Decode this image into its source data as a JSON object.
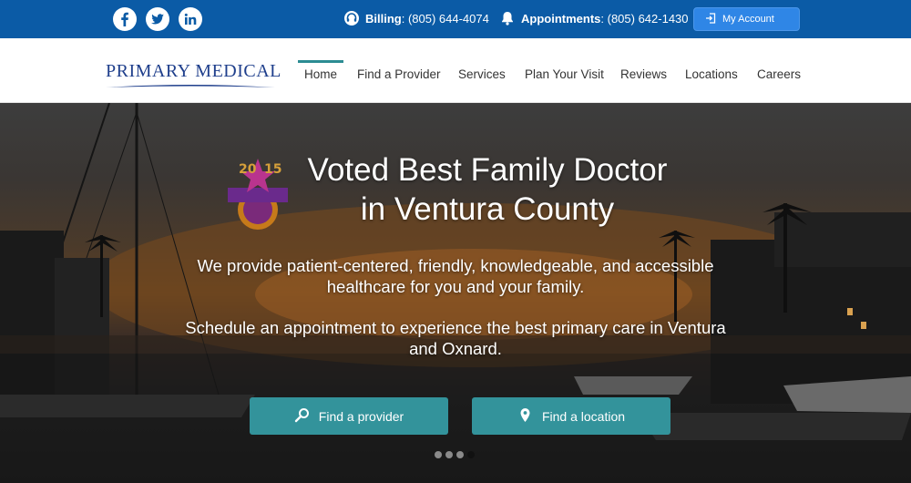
{
  "topbar": {
    "social": [
      "facebook-icon",
      "twitter-icon",
      "linkedin-icon"
    ],
    "billing_label": "Billing",
    "billing_phone": ": (805) 644-4074",
    "appointments_label": "Appointments",
    "appointments_phone": ": (805) 642-1430",
    "account_button": "My Account"
  },
  "logo": {
    "text": "PRIMARY MEDICAL"
  },
  "nav": {
    "items": [
      "Home",
      "Find a Provider",
      "Services",
      "Plan Your Visit",
      "Reviews",
      "Locations",
      "Careers"
    ],
    "active": "Home"
  },
  "hero": {
    "headline_line1": "Voted Best Family Doctor",
    "headline_line2": "in Ventura County",
    "badge_year": "2015",
    "paragraph1": "We provide patient-centered, friendly, knowledgeable, and accessible healthcare for you and your family.",
    "paragraph2": "Schedule an appointment to experience the best primary care in Ventura and Oxnard.",
    "cta_provider": "Find a provider",
    "cta_location": "Find a location",
    "slides": {
      "count": 4,
      "active": 4
    }
  },
  "colors": {
    "topbar": "#0b5ba6",
    "account_button": "#2f86e6",
    "accent": "#2c8c93",
    "cta": "#33939b",
    "logo": "#1f3f8c"
  }
}
